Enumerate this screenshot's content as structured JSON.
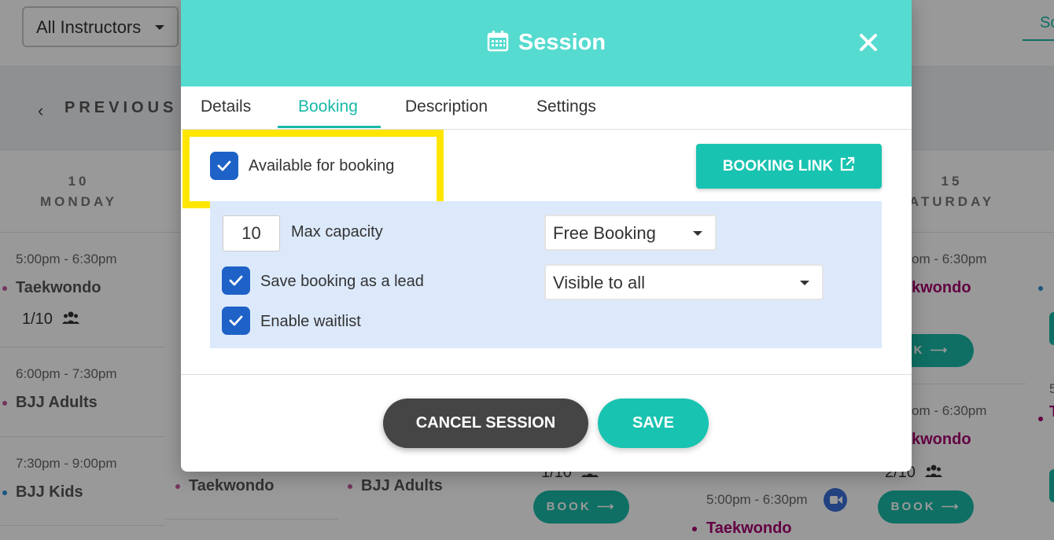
{
  "colors": {
    "accent": "#19c3b1",
    "header": "#55dbcf",
    "checkbox": "#1e62c7",
    "highlight": "#ffe600",
    "cancel": "#454545",
    "panel": "#dce9fb"
  },
  "background": {
    "instructor_filter": "All Instructors",
    "top_tab_partial": "Sc",
    "prev_label": "PREVIOUS",
    "days": [
      {
        "num": "10",
        "name": "MONDAY"
      },
      {
        "num": "15",
        "name": "ATURDAY"
      }
    ],
    "monday_events": [
      {
        "time": "5:00pm - 6:30pm",
        "name": "Taekwondo",
        "count": "1/10"
      },
      {
        "time": "6:00pm - 7:30pm",
        "name": "BJJ Adults"
      },
      {
        "time": "7:30pm - 9:00pm",
        "name": "BJJ Kids"
      }
    ],
    "col2_name": "Taekwondo",
    "col3_name": "BJJ Adults",
    "col4_count": "1/10",
    "col4_book": "BOOK",
    "col5_time": "5:00pm - 6:30pm",
    "col5_name": "Taekwondo",
    "col6_events": [
      {
        "time": "om - 6:30pm",
        "name": "kwondo",
        "book": "OK"
      },
      {
        "time": "om - 6:30pm",
        "name": "kwondo",
        "count": "2/10",
        "book": "BOOK"
      }
    ],
    "col7_partials": [
      "5",
      "T"
    ]
  },
  "modal": {
    "title": "Session",
    "tabs": [
      "Details",
      "Booking",
      "Description",
      "Settings"
    ],
    "active_tab": "Booking",
    "available_label": "Available for booking",
    "booking_link_label": "BOOKING LINK",
    "capacity_value": "10",
    "capacity_label": "Max capacity",
    "booking_type": "Free Booking",
    "visibility": "Visible to all",
    "save_lead_label": "Save booking as a lead",
    "waitlist_label": "Enable waitlist",
    "cancel_label": "CANCEL SESSION",
    "save_label": "SAVE"
  },
  "icons": [
    "calendar-icon",
    "close-icon",
    "external-link-icon",
    "check-icon",
    "people-icon",
    "video-icon",
    "chevron-left-icon",
    "caret-down-icon",
    "arrow-right-icon"
  ]
}
